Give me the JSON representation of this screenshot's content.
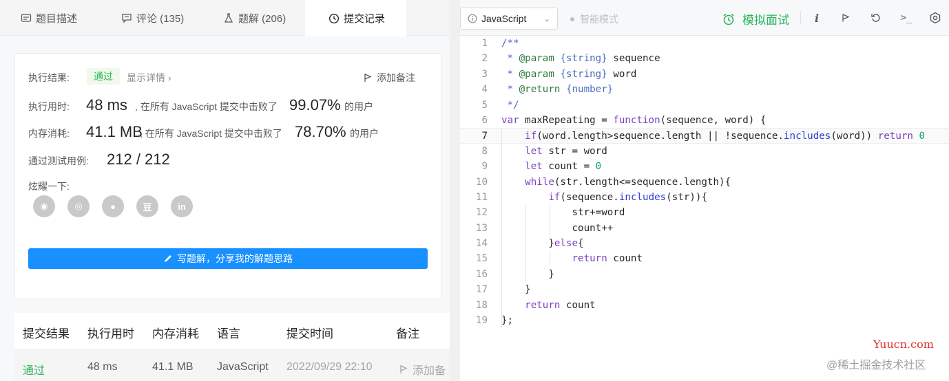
{
  "tabs": [
    {
      "icon": "description-icon",
      "label": "题目描述"
    },
    {
      "icon": "comment-icon",
      "label": "评论 (135)"
    },
    {
      "icon": "flask-icon",
      "label": "题解 (206)"
    },
    {
      "icon": "clock-icon",
      "label": "提交记录"
    }
  ],
  "result": {
    "label": "执行结果:",
    "status": "通过",
    "detail": "显示详情 ›",
    "add_note": "添加备注",
    "runtime_label": "执行用时:",
    "runtime_value": "48 ms",
    "runtime_text": ", 在所有 JavaScript 提交中击败了",
    "runtime_pct": "99.07%",
    "runtime_suffix": "的用户",
    "memory_label": "内存消耗:",
    "memory_value": "41.1 MB",
    "memory_text": ", 在所有 JavaScript 提交中击败了",
    "memory_pct": "78.70%",
    "memory_suffix": "的用户",
    "tests_label": "通过测试用例:",
    "tests_value": "212 / 212",
    "share_label": "炫耀一下:",
    "share_buttons": [
      "wechat-icon",
      "weibo-icon",
      "qq-icon",
      "douban-icon",
      "linkedin-icon"
    ],
    "share_glyphs": [
      "◉",
      "◎",
      "●",
      "豆",
      "in"
    ],
    "write_button": "写题解，分享我的解题思路"
  },
  "table": {
    "headers": [
      "提交结果",
      "执行用时",
      "内存消耗",
      "语言",
      "提交时间",
      "备注"
    ],
    "rows": [
      {
        "status": "通过",
        "runtime": "48 ms",
        "memory": "41.1 MB",
        "language": "JavaScript",
        "time": "2022/09/29 22:10",
        "note": "添加备"
      }
    ]
  },
  "editor": {
    "language": "JavaScript",
    "smart_mode": "智能模式",
    "mock_interview": "模拟面试",
    "toolbar_icons": [
      "info-icon",
      "run-icon",
      "reset-icon",
      "console-icon",
      "settings-icon"
    ],
    "code_lines": [
      "/**",
      " * @param {string} sequence",
      " * @param {string} word",
      " * @return {number}",
      " */",
      "var maxRepeating = function(sequence, word) {",
      "    if(word.length>sequence.length || !sequence.includes(word)) return 0",
      "    let str = word",
      "    let count = 0",
      "    while(str.length<=sequence.length){",
      "        if(sequence.includes(str)){",
      "            str+=word",
      "            count++",
      "        }else{",
      "            return count",
      "        }",
      "    }",
      "    return count",
      "};"
    ]
  },
  "watermark": {
    "site": "Yuucn.com",
    "community": "@稀土掘金技术社区"
  }
}
